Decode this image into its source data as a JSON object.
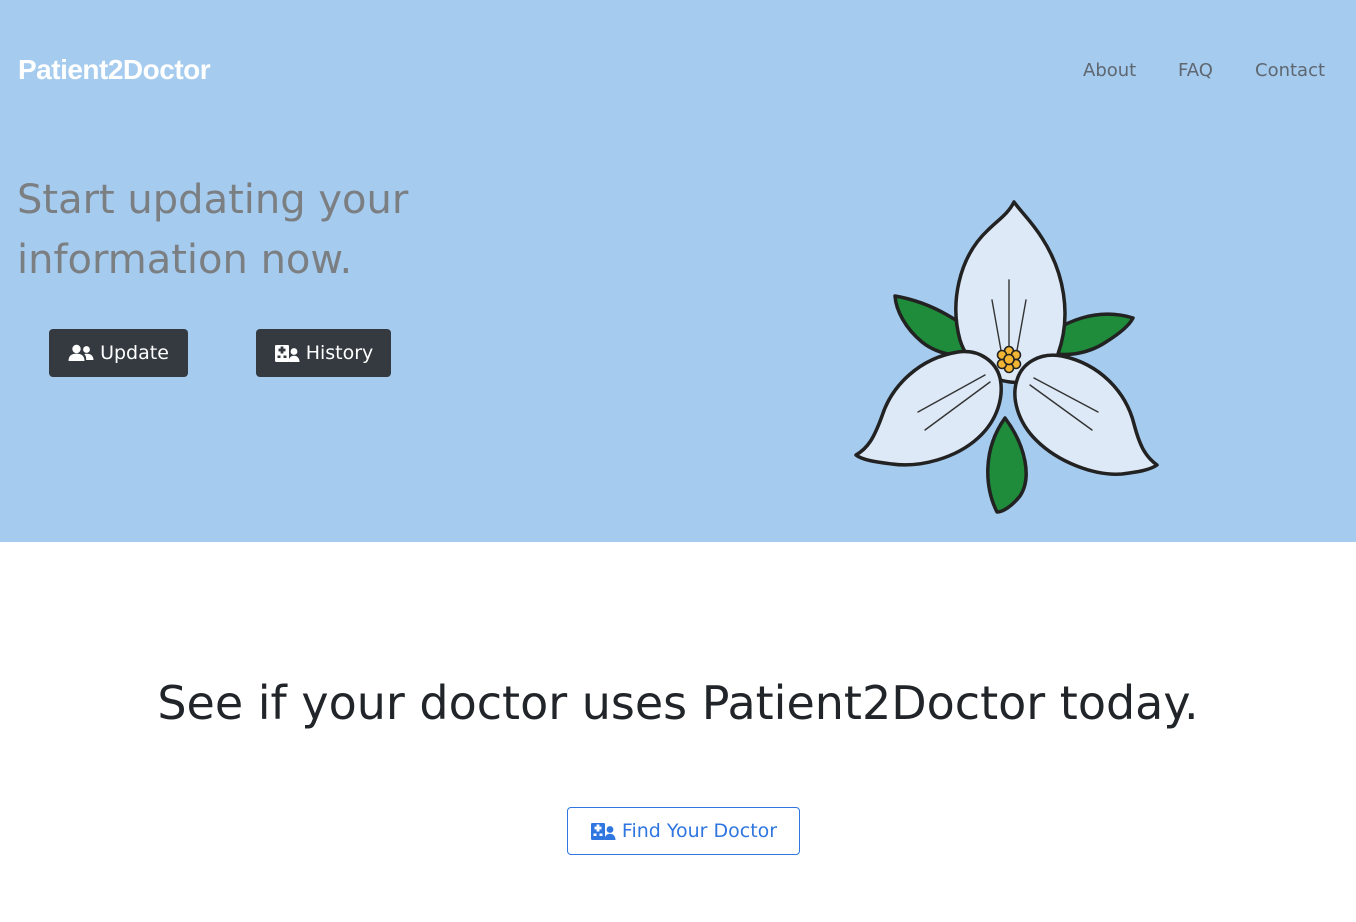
{
  "navbar": {
    "brand": "Patient2Doctor",
    "links": [
      {
        "label": "About"
      },
      {
        "label": "FAQ"
      },
      {
        "label": "Contact"
      }
    ]
  },
  "hero": {
    "title": "Start updating your information now.",
    "buttons": [
      {
        "label": "Update",
        "icon": "users-icon"
      },
      {
        "label": "History",
        "icon": "hospital-user-icon"
      }
    ],
    "image": "trillium-flower-icon"
  },
  "find_section": {
    "title": "See if your doctor uses Patient2Doctor today.",
    "button": {
      "label": "Find Your Doctor",
      "icon": "hospital-user-icon"
    }
  },
  "colors": {
    "hero_background": "#a5cbef",
    "dark_button": "#343a40",
    "primary": "#2f76e0",
    "leaf_green": "#1e8c3a",
    "petal": "#dde9f6",
    "flower_center": "#f2b533"
  }
}
